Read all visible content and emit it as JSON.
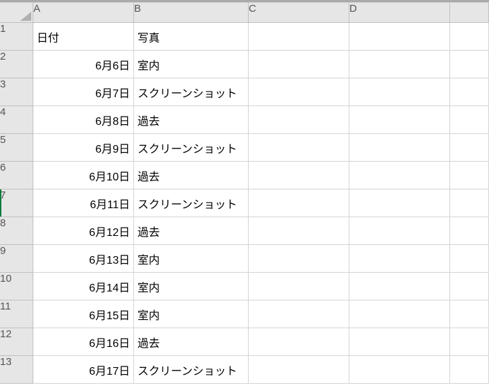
{
  "columns": [
    "A",
    "B",
    "C",
    "D"
  ],
  "rowHeaders": [
    "1",
    "2",
    "3",
    "4",
    "5",
    "6",
    "7",
    "8",
    "9",
    "10",
    "11",
    "12",
    "13"
  ],
  "selectedRow": 7,
  "headerRow": {
    "A": "日付",
    "B": "写真"
  },
  "rows": [
    {
      "A": "6月6日",
      "B": "室内"
    },
    {
      "A": "6月7日",
      "B": "スクリーンショット"
    },
    {
      "A": "6月8日",
      "B": "過去"
    },
    {
      "A": "6月9日",
      "B": "スクリーンショット"
    },
    {
      "A": "6月10日",
      "B": "過去"
    },
    {
      "A": "6月11日",
      "B": "スクリーンショット"
    },
    {
      "A": "6月12日",
      "B": "過去"
    },
    {
      "A": "6月13日",
      "B": "室内"
    },
    {
      "A": "6月14日",
      "B": "室内"
    },
    {
      "A": "6月15日",
      "B": "室内"
    },
    {
      "A": "6月16日",
      "B": "過去"
    },
    {
      "A": "6月17日",
      "B": "スクリーンショット"
    }
  ]
}
